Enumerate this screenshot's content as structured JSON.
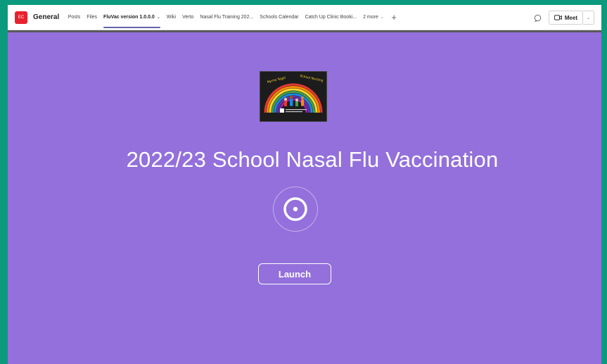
{
  "team": {
    "avatar_text": "EC",
    "channel_name": "General"
  },
  "tabs": [
    {
      "label": "Posts"
    },
    {
      "label": "Files"
    },
    {
      "label": "FluVac version 1.0.0.0",
      "active": true
    },
    {
      "label": "Wiki"
    },
    {
      "label": "Verto"
    },
    {
      "label": "Nasal Flu Training 202..."
    },
    {
      "label": "Schools Calendar"
    },
    {
      "label": "Catch Up Clinic Booki..."
    },
    {
      "label": "2 more"
    }
  ],
  "toolbar": {
    "meet_label": "Meet"
  },
  "main": {
    "logo_text_left": "Nyrrie Tegal",
    "logo_text_right": "School Nursing",
    "title": "2022/23 School Nasal Flu Vaccination",
    "launch_label": "Launch"
  },
  "colors": {
    "background": "#9370db",
    "accent": "#6264a7",
    "team_avatar": "#e8222c"
  }
}
